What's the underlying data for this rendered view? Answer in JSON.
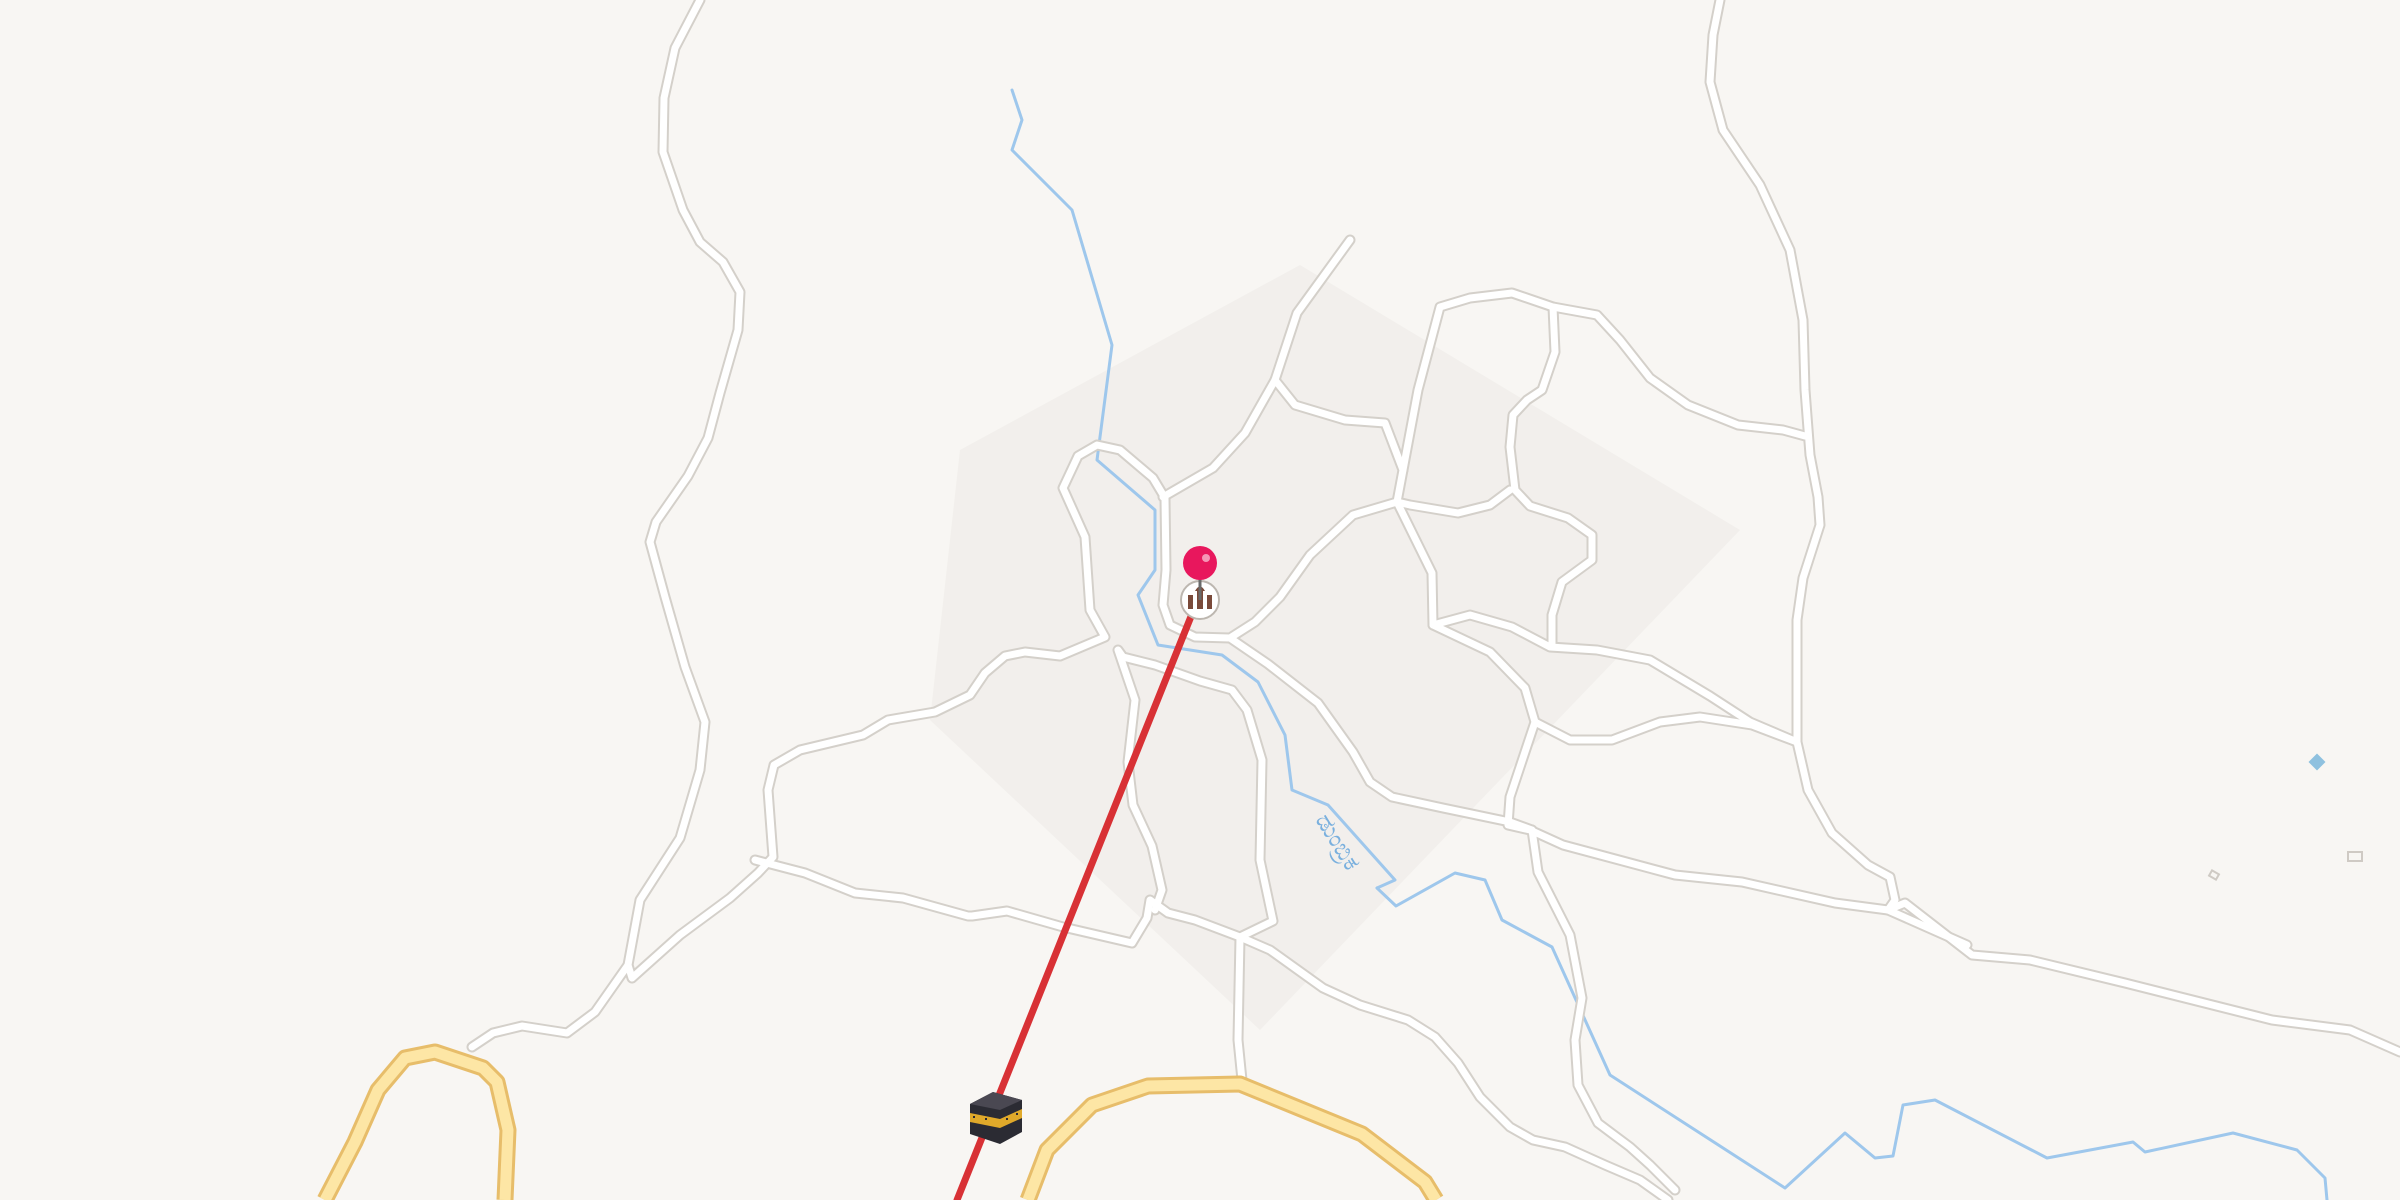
{
  "map": {
    "river_label": "ಡುಂಬ್ರಿಕ",
    "colors": {
      "background": "#f8f6f3",
      "landuse_area": "#f1eeeb",
      "road": "#ffffff",
      "road_casing": "#d4d0ca",
      "major_road": "#fde6a5",
      "major_road_casing": "#e7bd6a",
      "water": "#9ec7ec",
      "route_line": "#d83135",
      "pin": "#e8175d"
    },
    "markers": [
      {
        "name": "destination-pin",
        "icon": "red-pin-icon"
      },
      {
        "name": "mosque-poi",
        "icon": "mosque-icon"
      },
      {
        "name": "kaaba-marker",
        "icon": "kaaba-icon"
      }
    ]
  }
}
